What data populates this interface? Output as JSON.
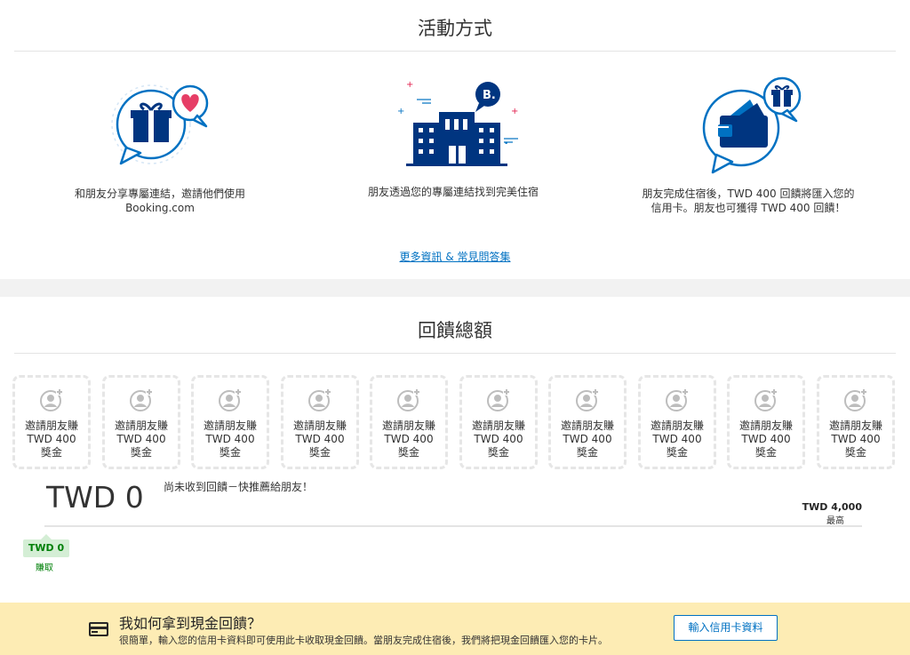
{
  "how_it_works": {
    "title": "活動方式",
    "steps": [
      {
        "icon": "gift-chat-icon",
        "line1": "和朋友分享專屬連結，邀請他們使用",
        "line2": "Booking.com"
      },
      {
        "icon": "hotel-booking-icon",
        "line1": "朋友透過您的專屬連結找到完美住宿",
        "line2": ""
      },
      {
        "icon": "wallet-gift-icon",
        "line1": "朋友完成住宿後，TWD 400 回饋將匯入您的",
        "line2": "信用卡。朋友也可獲得 TWD 400 回饋！"
      }
    ],
    "faq_link": "更多資訊 & 常見問答集"
  },
  "total": {
    "title": "回饋總額",
    "slots": [
      {
        "line1": "邀請朋友賺",
        "line2": "TWD 400",
        "line3": "獎金"
      },
      {
        "line1": "邀請朋友賺",
        "line2": "TWD 400",
        "line3": "獎金"
      },
      {
        "line1": "邀請朋友賺",
        "line2": "TWD 400",
        "line3": "獎金"
      },
      {
        "line1": "邀請朋友賺",
        "line2": "TWD 400",
        "line3": "獎金"
      },
      {
        "line1": "邀請朋友賺",
        "line2": "TWD 400",
        "line3": "獎金"
      },
      {
        "line1": "邀請朋友賺",
        "line2": "TWD 400",
        "line3": "獎金"
      },
      {
        "line1": "邀請朋友賺",
        "line2": "TWD 400",
        "line3": "獎金"
      },
      {
        "line1": "邀請朋友賺",
        "line2": "TWD 400",
        "line3": "獎金"
      },
      {
        "line1": "邀請朋友賺",
        "line2": "TWD 400",
        "line3": "獎金"
      },
      {
        "line1": "邀請朋友賺",
        "line2": "TWD 400",
        "line3": "獎金"
      }
    ],
    "amount": "TWD 0",
    "hint": "尚未收到回饋－快推薦給朋友！",
    "max_amount": "TWD 4,000",
    "max_label": "最高",
    "earned_amount": "TWD 0",
    "earned_label": "賺取",
    "progress_fraction": 0
  },
  "banner": {
    "icon": "credit-card-icon",
    "title": "我如何拿到現金回饋？",
    "description": "很簡單，輸入您的信用卡資料即可使用此卡收取現金回饋。當朋友完成住宿後，我們將把現金回饋匯入您的卡片。",
    "cta": "輸入信用卡資料"
  },
  "colors": {
    "brand_blue": "#003580",
    "link_blue": "#0071c2",
    "accent_red": "#e21c4b",
    "earned_green": "#008009",
    "banner_bg": "#fdecb4"
  }
}
